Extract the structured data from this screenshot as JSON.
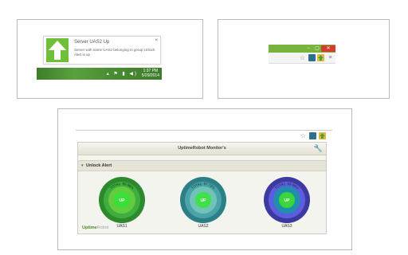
{
  "notification": {
    "title": "Server UAS2 Up",
    "body": "Server with name UAS2 belonging to group Unlock Alert is up",
    "close": "×",
    "time": "1:37 PM",
    "date": "5/29/2014",
    "tray_icons": "▴ ⚑ ▮ ◀)"
  },
  "browser_window": {
    "minimize": "−",
    "maximize": "▢",
    "close": "✕",
    "star": "☆"
  },
  "popup": {
    "title": "UptimeRobot Monitor's",
    "group": {
      "caret": "▾",
      "label": "Unlock Alert"
    },
    "monitors": [
      {
        "name": "UAS1",
        "status": "UP",
        "ring_text": "TOTAL: 99.99%",
        "colors": [
          "#2c8a2c",
          "#3fae3f",
          "#62cc3e",
          "#3ae03a"
        ]
      },
      {
        "name": "UAS2",
        "status": "UP",
        "ring_text": "TOTAL: 97.72%",
        "colors": [
          "#2c7f86",
          "#4aa3a9",
          "#6fc3b7",
          "#3fe04a"
        ]
      },
      {
        "name": "UAS3",
        "status": "UP",
        "ring_text": "TOTAL: 99.99%",
        "colors": [
          "#3d39a0",
          "#5d5de0",
          "#1f8fae",
          "#3ad63a"
        ]
      }
    ],
    "logo_a": "Uptime",
    "logo_b": "Robot"
  },
  "colors": {
    "accent_green": "#78b43c",
    "close_red": "#d83a2e"
  }
}
